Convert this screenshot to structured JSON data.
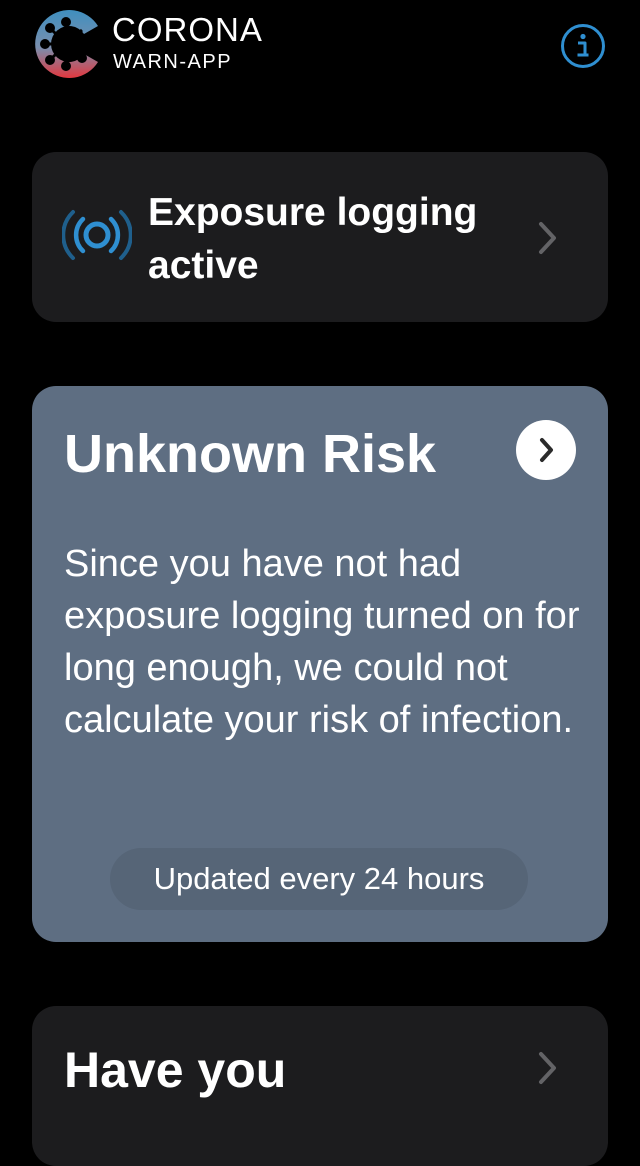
{
  "header": {
    "brand_name": "CORONA",
    "brand_sub": "WARN-APP",
    "logo_icon": "corona-warn-app-logo",
    "info_icon": "info-circle-icon"
  },
  "exposure_card": {
    "label": "Exposure logging active",
    "icon": "broadcast-waves-icon",
    "chevron_icon": "chevron-right-icon"
  },
  "risk_card": {
    "title": "Unknown Risk",
    "description": "Since you have not had exposure logging turned on for long enough, we could not calculate your risk of infection.",
    "updated": "Updated every 24 hours",
    "chevron_icon": "chevron-right-icon"
  },
  "have_you_card": {
    "title": "Have you",
    "chevron_icon": "chevron-right-icon"
  },
  "colors": {
    "background": "#000000",
    "card_dark": "#1c1c1e",
    "risk_card": "#5e6e82",
    "accent_blue": "#2f8fd1",
    "chevron_gray": "#636366"
  }
}
